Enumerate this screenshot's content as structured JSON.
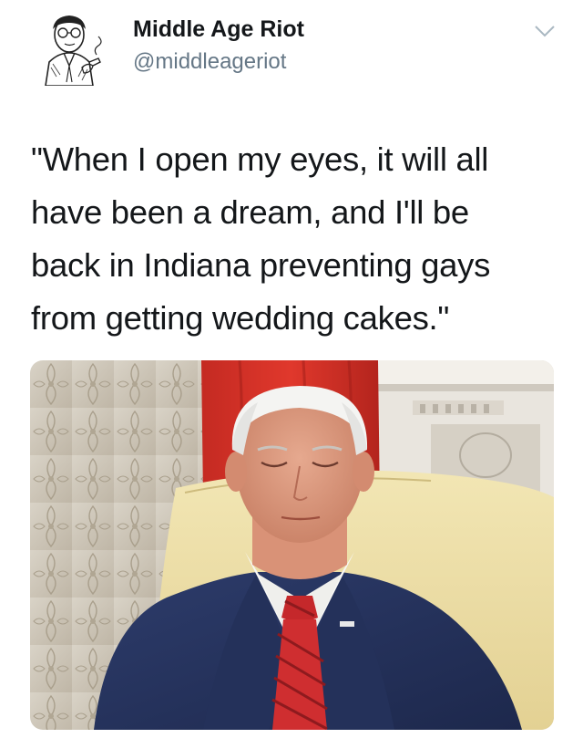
{
  "tweet": {
    "display_name": "Middle Age Riot",
    "handle": "@middleageriot",
    "text": "\"When I open my eyes, it will all\nhave been a dream, and I'll be\nback in Indiana preventing gays\nfrom getting wedding cakes.\"",
    "menu_icon": "chevron-down-icon",
    "colors": {
      "text": "#14171a",
      "secondary": "#657786",
      "caret": "#aab8c2"
    }
  }
}
